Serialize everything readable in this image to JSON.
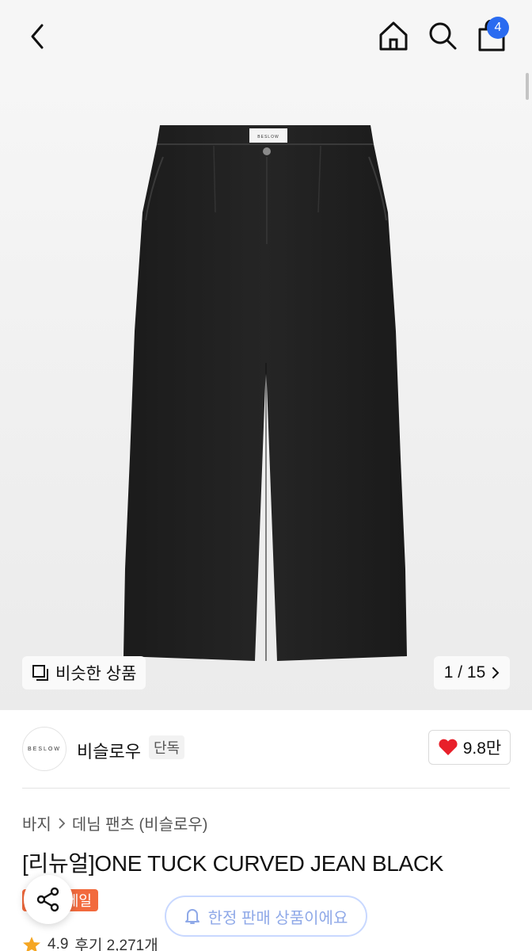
{
  "header": {
    "back_icon": "chevron-left-icon",
    "home_icon": "home-icon",
    "search_icon": "search-icon",
    "bag_icon": "shopping-bag-icon",
    "cart_count": "4",
    "badge_color": "#2a6bf0"
  },
  "hero": {
    "waistband_label": "BESLOW",
    "similar_label": "비슷한 상품",
    "pager": "1 / 15"
  },
  "brand": {
    "logo_text": "BESLOW",
    "name": "비슬로우",
    "tag": "단독",
    "likes": "9.8만",
    "heart_color": "#e8202a"
  },
  "breadcrumb": {
    "category": "바지",
    "subcategory": "데님 팬츠 (비슬로우)"
  },
  "product": {
    "title": "[리뉴얼]ONE TUCK CURVED JEAN BLACK",
    "sale_badge": "세일",
    "rating": "4.9",
    "reviews": "후기 2,271개"
  },
  "floating": {
    "share_icon": "share-icon",
    "limited_label": "한정 판매 상품이에요"
  }
}
